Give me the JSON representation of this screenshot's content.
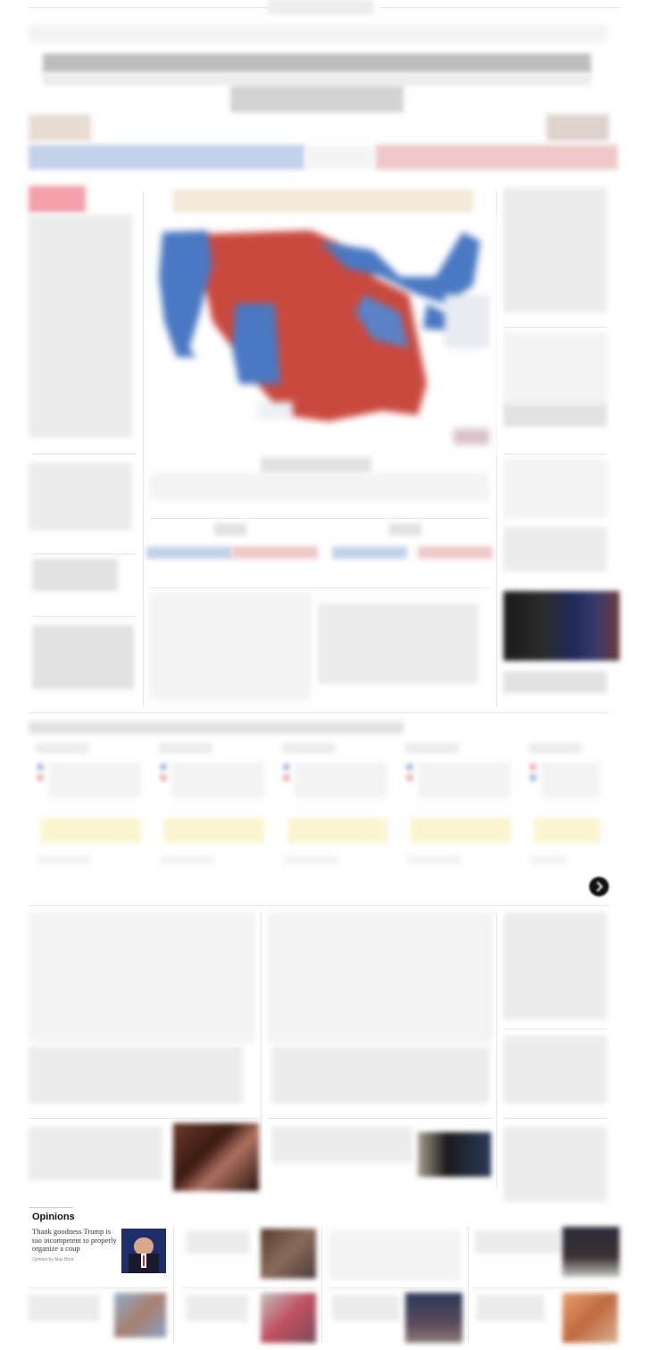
{
  "colors": {
    "democrat_blue": "#4a78c2",
    "republican_red": "#c9493f",
    "breaking_red": "#f2707f",
    "trend_yellow": "#fbf5cf"
  },
  "opinions": {
    "section_title": "Opinions",
    "lead": {
      "headline": "Thank goodness Trump is too incompetent to properly organize a coup",
      "byline": "Opinion by Max Boot"
    }
  },
  "icons": {
    "carousel_next": "chevron-right-icon"
  }
}
